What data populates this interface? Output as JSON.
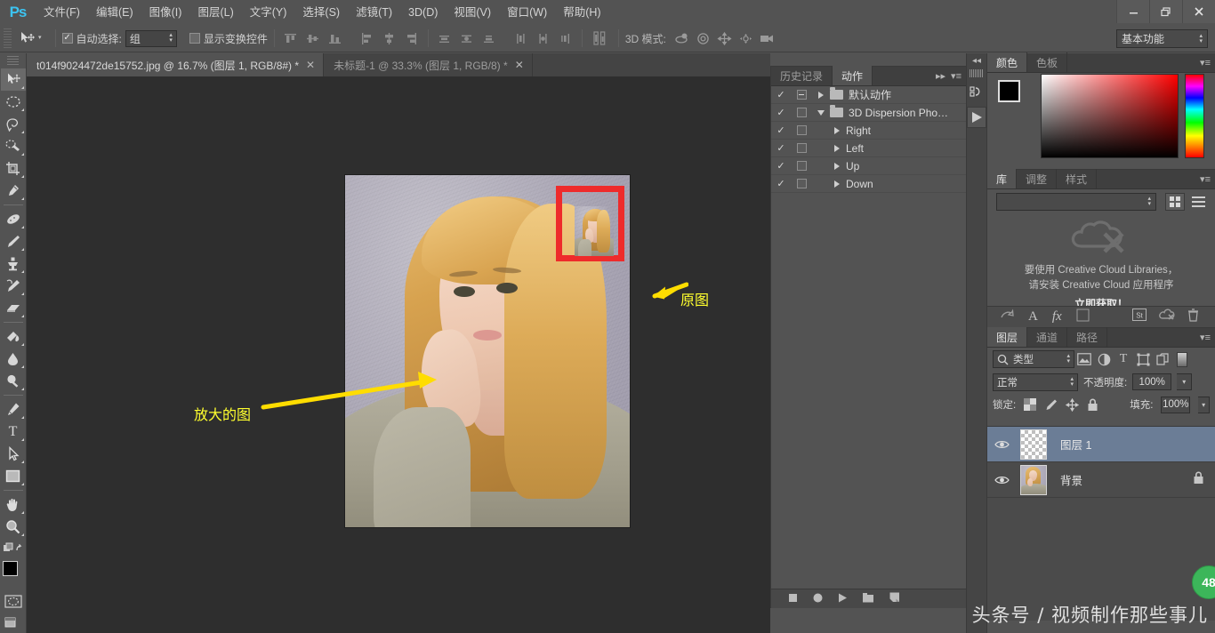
{
  "app": {
    "logo": "Ps",
    "menu": [
      "文件(F)",
      "编辑(E)",
      "图像(I)",
      "图层(L)",
      "文字(Y)",
      "选择(S)",
      "滤镜(T)",
      "3D(D)",
      "视图(V)",
      "窗口(W)",
      "帮助(H)"
    ],
    "window_controls": {
      "minimize": "—",
      "restore": "❐",
      "close": "✕"
    }
  },
  "options_bar": {
    "auto_select_label": "自动选择:",
    "auto_select_checked": "✓",
    "auto_select_value": "组",
    "show_transform_label": "显示变换控件",
    "show_transform_checked": "",
    "mode_3d_label": "3D 模式:",
    "workspace": "基本功能"
  },
  "tabs": [
    {
      "label": "t014f9024472de15752.jpg @ 16.7% (图层 1, RGB/8#) *",
      "close": "✕",
      "active": true
    },
    {
      "label": "未标题-1 @ 33.3% (图层 1, RGB/8) *",
      "close": "✕",
      "active": false
    }
  ],
  "toolbar": {
    "tools": [
      {
        "name": "move-tool",
        "glyph": "move",
        "active": true
      },
      {
        "name": "elliptical-marquee-tool",
        "glyph": "ellipse",
        "active": false
      },
      {
        "name": "lasso-tool",
        "glyph": "lasso",
        "active": false
      },
      {
        "name": "quick-selection-tool",
        "glyph": "quickselect",
        "active": false
      },
      {
        "name": "crop-tool",
        "glyph": "crop",
        "active": false
      },
      {
        "name": "eyedropper-tool",
        "glyph": "eyedropper",
        "active": false
      },
      {
        "name": "spot-healing-brush-tool",
        "glyph": "heal",
        "active": false
      },
      {
        "name": "brush-tool",
        "glyph": "brush",
        "active": false
      },
      {
        "name": "clone-stamp-tool",
        "glyph": "stamp",
        "active": false
      },
      {
        "name": "history-brush-tool",
        "glyph": "historybrush",
        "active": false
      },
      {
        "name": "eraser-tool",
        "glyph": "eraser",
        "active": false
      },
      {
        "name": "gradient-tool",
        "glyph": "gradient",
        "active": false
      },
      {
        "name": "blur-tool",
        "glyph": "blur",
        "active": false
      },
      {
        "name": "dodge-tool",
        "glyph": "dodge",
        "active": false
      },
      {
        "name": "pen-tool",
        "glyph": "pen",
        "active": false
      },
      {
        "name": "horizontal-type-tool",
        "glyph": "type",
        "active": false
      },
      {
        "name": "path-selection-tool",
        "glyph": "pathselect",
        "active": false
      },
      {
        "name": "rectangle-tool",
        "glyph": "rect",
        "active": false
      },
      {
        "name": "hand-tool",
        "glyph": "hand",
        "active": false
      },
      {
        "name": "zoom-tool",
        "glyph": "zoom",
        "active": false
      }
    ],
    "foreground_color": "#000000",
    "background_color": "#ffffff"
  },
  "canvas": {
    "annotations": [
      {
        "name": "original-image-annotation",
        "text": "原图"
      },
      {
        "name": "enlarged-image-annotation",
        "text": "放大的图"
      }
    ],
    "marker_color": "#ee2b2b",
    "annotation_color": "#ffff2e"
  },
  "actions_panel": {
    "tabs": [
      {
        "label": "历史记录",
        "active": false
      },
      {
        "label": "动作",
        "active": true
      }
    ],
    "rows": [
      {
        "check": "✓",
        "has_box": true,
        "box_mark": "▤",
        "arrow": "right",
        "folder": true,
        "label": "默认动作",
        "indent": 0
      },
      {
        "check": "✓",
        "has_box": true,
        "box_mark": "",
        "arrow": "down",
        "folder": true,
        "label": "3D Dispersion Pho…",
        "indent": 0
      },
      {
        "check": "✓",
        "has_box": true,
        "box_mark": "",
        "arrow": "right",
        "folder": false,
        "label": "Right",
        "indent": 1
      },
      {
        "check": "✓",
        "has_box": true,
        "box_mark": "",
        "arrow": "right",
        "folder": false,
        "label": "Left",
        "indent": 1
      },
      {
        "check": "✓",
        "has_box": true,
        "box_mark": "",
        "arrow": "right",
        "folder": false,
        "label": "Up",
        "indent": 1
      },
      {
        "check": "✓",
        "has_box": true,
        "box_mark": "",
        "arrow": "right",
        "folder": false,
        "label": "Down",
        "indent": 1
      }
    ],
    "footer_buttons": [
      "stop",
      "record",
      "play",
      "new-set",
      "new-action"
    ]
  },
  "color_panel": {
    "tabs": [
      {
        "label": "颜色",
        "active": true
      },
      {
        "label": "色板",
        "active": false
      }
    ],
    "foreground": "#000000",
    "background": "#ffffff"
  },
  "libraries_panel": {
    "tabs": [
      {
        "label": "库",
        "active": true
      },
      {
        "label": "调整",
        "active": false
      },
      {
        "label": "样式",
        "active": false
      }
    ],
    "message_line1": "要使用 Creative Cloud Libraries，",
    "message_line2": "请安装 Creative Cloud 应用程序",
    "cta": "立即获取！"
  },
  "layers_panel": {
    "tabs": [
      {
        "label": "图层",
        "active": true
      },
      {
        "label": "通道",
        "active": false
      },
      {
        "label": "路径",
        "active": false
      }
    ],
    "filter_label": "类型",
    "blend_mode": "正常",
    "opacity_label": "不透明度:",
    "opacity_value": "100%",
    "lock_label": "锁定:",
    "fill_label": "填充:",
    "fill_value": "100%",
    "layers": [
      {
        "name": "图层 1",
        "selected": true,
        "visible": true,
        "locked": false,
        "thumb": "transparent"
      },
      {
        "name": "背景",
        "selected": false,
        "visible": true,
        "locked": true,
        "thumb": "photo"
      }
    ]
  },
  "badge": {
    "text": "48",
    "color": "#3cb65a"
  },
  "watermark": {
    "text": "头条号 / 视频制作那些事儿"
  }
}
